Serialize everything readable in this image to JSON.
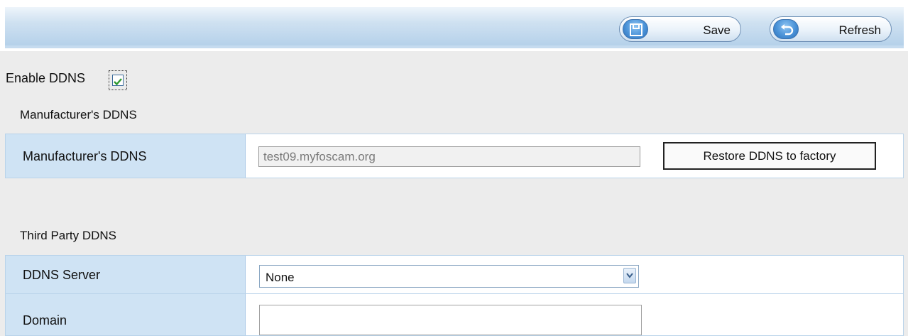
{
  "toolbar": {
    "save_label": "Save",
    "refresh_label": "Refresh",
    "save_icon": "floppy-disk-icon",
    "refresh_icon": "undo-arrow-icon"
  },
  "enable_ddns": {
    "label": "Enable DDNS",
    "checked": true
  },
  "manufacturer": {
    "section_title": "Manufacturer's DDNS",
    "row_label": "Manufacturer's DDNS",
    "value": "test09.myfoscam.org",
    "restore_label": "Restore DDNS to factory"
  },
  "third_party": {
    "section_title": "Third Party DDNS",
    "server_label": "DDNS Server",
    "server_value": "None",
    "domain_label": "Domain",
    "domain_value": ""
  },
  "colors": {
    "toolbar_band": "#b5d1ea",
    "row_header": "#cfe3f4",
    "checkmark": "#2f9a2f"
  }
}
